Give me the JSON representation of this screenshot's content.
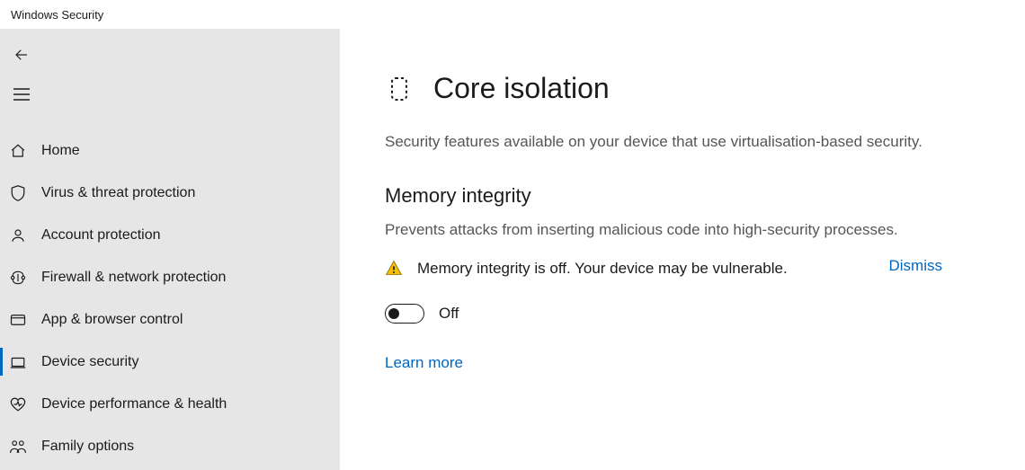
{
  "window": {
    "title": "Windows Security"
  },
  "sidebar": {
    "items": [
      {
        "icon": "home-icon",
        "label": "Home"
      },
      {
        "icon": "shield-icon",
        "label": "Virus & threat protection"
      },
      {
        "icon": "account-icon",
        "label": "Account protection"
      },
      {
        "icon": "firewall-icon",
        "label": "Firewall & network protection"
      },
      {
        "icon": "browser-icon",
        "label": "App & browser control"
      },
      {
        "icon": "device-icon",
        "label": "Device security"
      },
      {
        "icon": "health-icon",
        "label": "Device performance & health"
      },
      {
        "icon": "family-icon",
        "label": "Family options"
      }
    ]
  },
  "main": {
    "title": "Core isolation",
    "subtitle": "Security features available on your device that use virtualisation-based security.",
    "section": {
      "title": "Memory integrity",
      "description": "Prevents attacks from inserting malicious code into high-security processes.",
      "alert_text": "Memory integrity is off. Your device may be vulnerable.",
      "dismiss_label": "Dismiss",
      "toggle_state": "Off",
      "learn_more": "Learn more"
    }
  }
}
